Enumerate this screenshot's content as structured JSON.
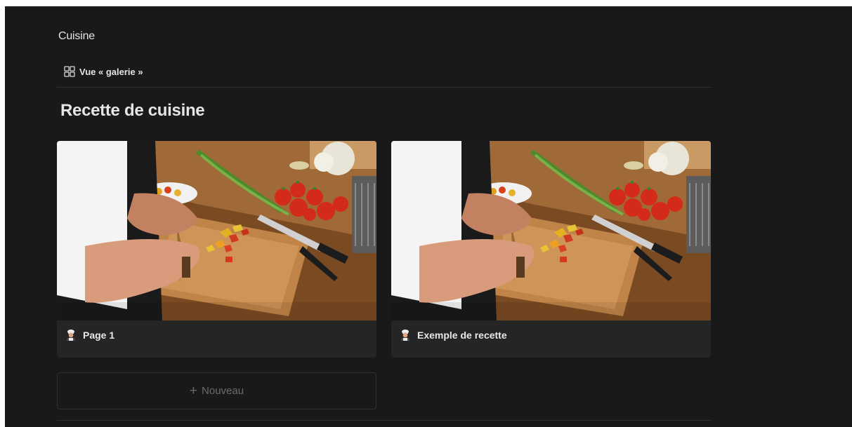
{
  "breadcrumb": {
    "label": "Cuisine"
  },
  "view": {
    "label": "Vue « galerie »",
    "icon": "gallery-view-icon"
  },
  "gallery": {
    "title": "Recette de cuisine",
    "cards": [
      {
        "title": "Page 1",
        "icon": "cook-icon",
        "cover": "cooking-photo"
      },
      {
        "title": "Exemple de recette",
        "icon": "cook-icon",
        "cover": "cooking-photo"
      }
    ],
    "new_label": "Nouveau"
  },
  "colors": {
    "background": "#191919",
    "card": "#252525",
    "text": "#e5e5e5",
    "muted": "#6b6b6b",
    "divider": "#2f2f2f"
  }
}
